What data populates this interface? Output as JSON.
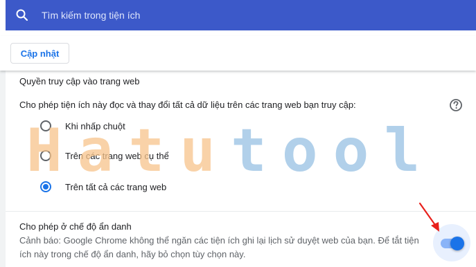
{
  "search": {
    "placeholder": "Tìm kiếm trong tiện ích",
    "icon": "search-icon"
  },
  "toolbar": {
    "update_label": "Cập nhật"
  },
  "site_access": {
    "title": "Quyền truy cập vào trang web",
    "description": "Cho phép tiện ích này đọc và thay đổi tất cả dữ liệu trên các trang web bạn truy cập:",
    "options": [
      {
        "label": "Khi nhấp chuột",
        "selected": false
      },
      {
        "label": "Trên các trang web cụ thể",
        "selected": false
      },
      {
        "label": "Trên tất cả các trang web",
        "selected": true
      }
    ]
  },
  "incognito": {
    "title": "Cho phép ở chế độ ẩn danh",
    "warning": "Cảnh báo: Google Chrome không thể ngăn các tiện ích ghi lại lịch sử duyệt web của bạn. Để tắt tiện ích này trong chế độ ẩn danh, hãy bỏ chọn tùy chọn này.",
    "enabled": true
  },
  "watermark": {
    "part1": "Hatu",
    "part2": "tool"
  },
  "colors": {
    "search_bar": "#3c59c9",
    "accent": "#1a73e8",
    "watermark_orange": "#f7c48b",
    "watermark_blue": "#a9cce8",
    "arrow": "#e8201c"
  }
}
